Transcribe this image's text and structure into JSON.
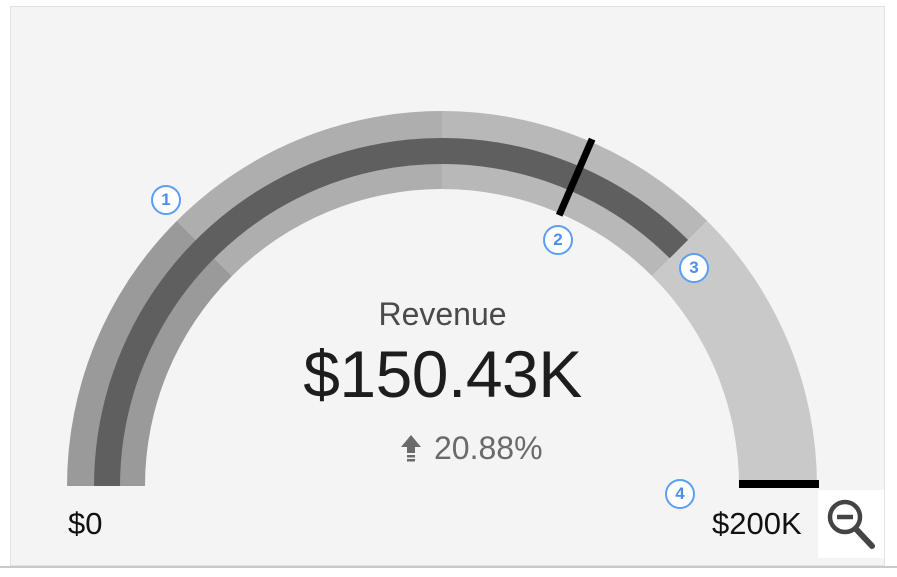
{
  "gauge": {
    "title": "Revenue",
    "value_label": "$150.43K",
    "value": 150430,
    "min_label": "$0",
    "max_label": "$200K",
    "min": 0,
    "max": 200000,
    "target_fraction": 0.63,
    "value_fraction": 0.75,
    "band_edges_fractions": [
      0.25,
      0.5,
      0.75
    ],
    "delta_label": "20.88%",
    "delta_direction": "up",
    "delta_icon": "arrow-up-icon",
    "colors": {
      "band_1": "#9a9a9a",
      "band_2": "#aeaeae",
      "band_3": "#b8b8b8",
      "band_4": "#c9c9c9",
      "value_bar": "#5f5f5f",
      "target_tick": "#000000",
      "marker": "#5c9ef4"
    }
  },
  "markers": [
    "1",
    "2",
    "3",
    "4"
  ],
  "toolbar": {
    "zoom_icon": "zoom-out-icon"
  }
}
